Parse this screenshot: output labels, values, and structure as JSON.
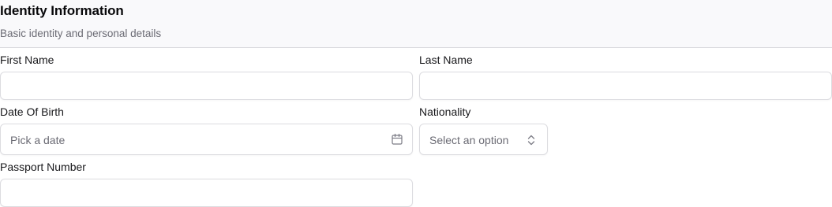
{
  "section": {
    "title": "Identity Information",
    "subtitle": "Basic identity and personal details"
  },
  "fields": {
    "first_name": {
      "label": "First Name",
      "value": ""
    },
    "last_name": {
      "label": "Last Name",
      "value": ""
    },
    "date_of_birth": {
      "label": "Date Of Birth",
      "placeholder": "Pick a date",
      "icon": "calendar-icon"
    },
    "nationality": {
      "label": "Nationality",
      "placeholder": "Select an option",
      "icon": "chevron-up-down-icon"
    },
    "passport_number": {
      "label": "Passport Number",
      "value": ""
    }
  },
  "colors": {
    "border": "#dcdce0",
    "placeholder": "#6b6b74",
    "header_bg": "#f9f9fb"
  }
}
